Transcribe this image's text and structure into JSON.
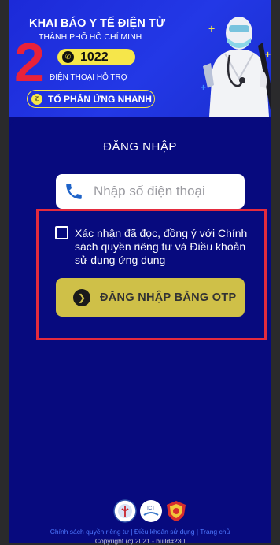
{
  "banner": {
    "title": "KHAI BÁO Y TẾ ĐIỆN TỬ",
    "city": "THÀNH PHỐ HỒ CHÍ MINH",
    "big_number": "2",
    "hotline": "1022",
    "support_label": "ĐIỆN THOẠI HỖ TRỢ",
    "quick_button": "TỔ PHẢN ỨNG NHANH"
  },
  "login": {
    "title": "ĐĂNG NHẬP",
    "phone_placeholder": "Nhập số điện thoại",
    "phone_value": "",
    "consent_text": "Xác nhận đã đọc, đồng ý với Chính sách quyền riêng tư và Điều khoản sử dụng ứng dụng",
    "consent_checked": false,
    "otp_button": "ĐĂNG NHẬP BẰNG OTP"
  },
  "footer": {
    "link_privacy": "Chính sách quyền riêng tư",
    "link_terms": "Điều khoản sử dụng",
    "link_home": "Trang chủ",
    "separator": " | ",
    "copyright": "Copyright (c) 2021 - build#230",
    "logos": [
      "ministry-of-health-logo",
      "ict-logo",
      "shield-logo"
    ]
  },
  "colors": {
    "page_bg": "#070a7e",
    "banner_blue": "#2338e6",
    "accent_yellow": "#f6e64a",
    "button_gold": "#cfc048",
    "highlight_red": "#e42b3e",
    "link_blue": "#4d77ff"
  }
}
